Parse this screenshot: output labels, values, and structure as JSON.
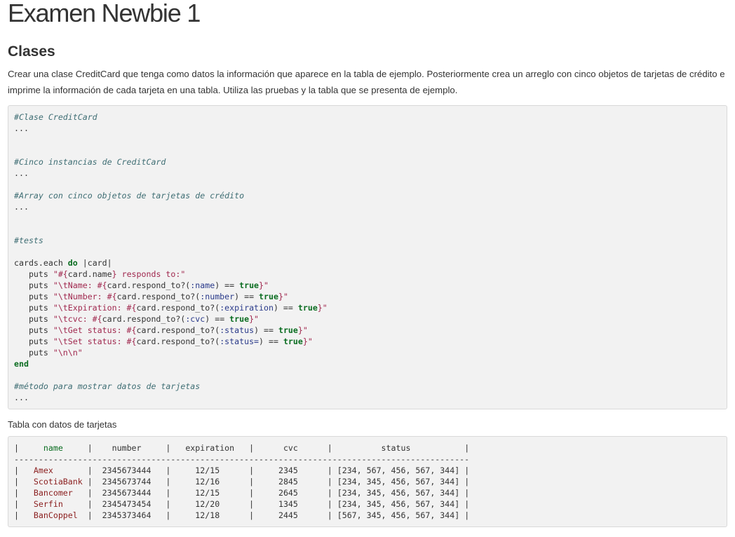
{
  "page_title": "Examen Newbie 1",
  "section_title": "Clases",
  "description": "Crear una clase CreditCard que tenga como datos la información que aparece en la tabla de ejemplo. Posteriormente crea un arreglo con cinco objetos de tarjetas de crédito e imprime la información de cada tarjeta en una tabla. Utiliza las pruebas y la tabla que se presenta de ejemplo.",
  "code": {
    "comment_class": "#Clase CreditCard",
    "ellipsis": "...",
    "comment_instances": "#Cinco instancias de CreditCard",
    "comment_array": "#Array con cinco objetos de tarjetas de crédito",
    "comment_tests": "#tests",
    "comment_method": "#método para mostrar datos de tarjetas"
  },
  "table_caption": "Tabla con datos de tarjetas",
  "table": {
    "headers": [
      "name",
      "number",
      "expiration",
      "cvc",
      "status"
    ],
    "rows": [
      {
        "name": "Amex",
        "number": "2345673444",
        "expiration": "12/15",
        "cvc": "2345",
        "status": "[234, 567, 456, 567, 344]"
      },
      {
        "name": "ScotiaBank",
        "number": "2345673744",
        "expiration": "12/16",
        "cvc": "2845",
        "status": "[234, 345, 456, 567, 344]"
      },
      {
        "name": "Bancomer",
        "number": "2345673444",
        "expiration": "12/15",
        "cvc": "2645",
        "status": "[234, 345, 456, 567, 344]"
      },
      {
        "name": "Serfin",
        "number": "2345473454",
        "expiration": "12/20",
        "cvc": "1345",
        "status": "[234, 345, 456, 567, 344]"
      },
      {
        "name": "BanCoppel",
        "number": "2345373464",
        "expiration": "12/18",
        "cvc": "2445",
        "status": "[567, 345, 456, 567, 344]"
      }
    ]
  }
}
